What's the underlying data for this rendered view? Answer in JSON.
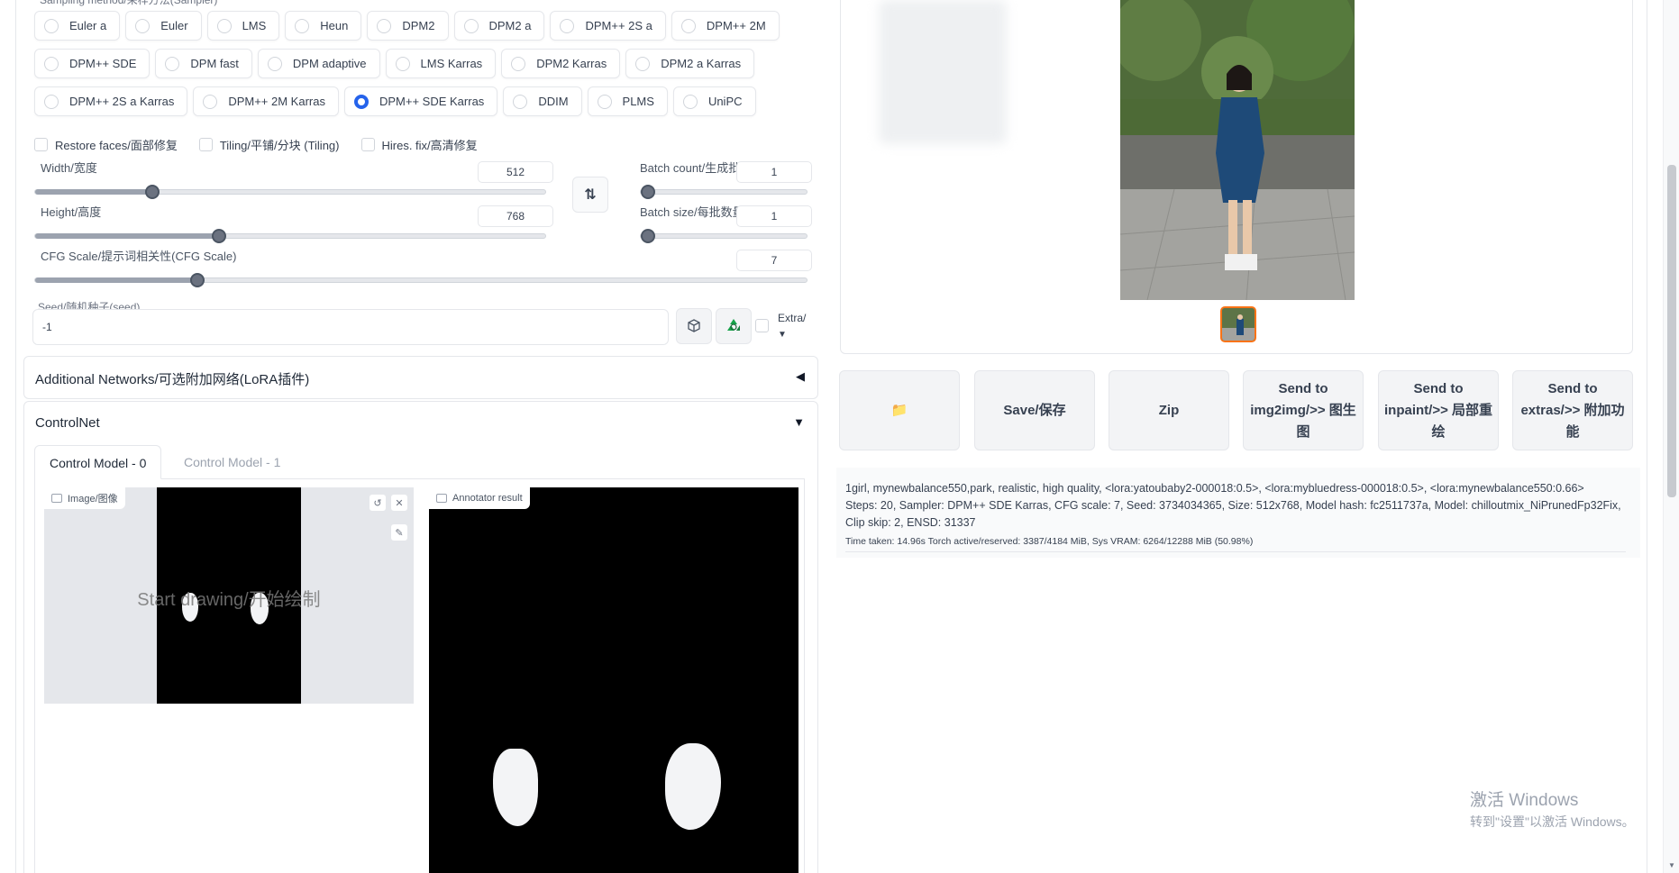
{
  "sampler": {
    "label": "Sampling method/采样方法(Sampler)",
    "row1": [
      "Euler a",
      "Euler",
      "LMS",
      "Heun",
      "DPM2",
      "DPM2 a",
      "DPM++ 2S a",
      "DPM++ 2M"
    ],
    "row2": [
      "DPM++ SDE",
      "DPM fast",
      "DPM adaptive",
      "LMS Karras",
      "DPM2 Karras",
      "DPM2 a Karras"
    ],
    "row3": [
      "DPM++ 2S a Karras",
      "DPM++ 2M Karras",
      "DPM++ SDE Karras",
      "DDIM",
      "PLMS",
      "UniPC"
    ],
    "selected": "DPM++ SDE Karras"
  },
  "options": {
    "restore_faces": "Restore faces/面部修复",
    "tiling": "Tiling/平铺/分块 (Tiling)",
    "hires_fix": "Hires. fix/高清修复"
  },
  "sliders": {
    "width": {
      "label": "Width/宽度",
      "value": "512",
      "level": 0.23
    },
    "height": {
      "label": "Height/高度",
      "value": "768",
      "level": 0.36
    },
    "batch_count": {
      "label": "Batch count/生成批次",
      "value": "1",
      "level": 0.0
    },
    "batch_size": {
      "label": "Batch size/每批数量",
      "value": "1",
      "level": 0.0
    },
    "cfg": {
      "label": "CFG Scale/提示词相关性(CFG Scale)",
      "value": "7",
      "level": 0.21
    }
  },
  "swap_icon": "⇅",
  "seed": {
    "label": "Seed/随机种子(seed)",
    "value": "-1",
    "random_icon": "dice-icon",
    "reuse_icon": "recycle-icon"
  },
  "extra": {
    "label": "Extra/",
    "arrow": "▼"
  },
  "additional_networks": {
    "title": "Additional Networks/可选附加网络(LoRA插件)",
    "arrow": "◀"
  },
  "controlnet": {
    "title": "ControlNet",
    "arrow": "▼",
    "tabs": [
      "Control Model - 0",
      "Control Model - 1"
    ],
    "image_label": "Image/图像",
    "canvas_hint": "Start drawing/开始绘制",
    "annotator_label": "Annotator result"
  },
  "gallery_actions": [
    "Save/保存",
    "Zip",
    "Send to img2img/>> 图生图",
    "Send to inpaint/>> 局部重绘",
    "Send to extras/>> 附加功能"
  ],
  "folder_icon": "📁",
  "generation_info": {
    "prompt": "1girl, mynewbalance550,park, realistic, high quality, <lora:yatoubaby2-000018:0.5>, <lora:mybluedress-000018:0.5>, <lora:mynewbalance550:0.66>",
    "params": "Steps: 20, Sampler: DPM++ SDE Karras, CFG scale: 7, Seed: 3734034365, Size: 512x768, Model hash: fc2511737a, Model: chilloutmix_NiPrunedFp32Fix, Clip skip: 2, ENSD: 31337",
    "perf": "Time taken: 14.96s  Torch active/reserved: 3387/4184 MiB, Sys VRAM: 6264/12288 MiB (50.98%)"
  },
  "watermark": {
    "line1": "激活 Windows",
    "line2": "转到\"设置\"以激活 Windows。"
  },
  "colors": {
    "accent": "#2563eb",
    "thumb_border": "#f97316",
    "recycle": "#16a34a"
  }
}
